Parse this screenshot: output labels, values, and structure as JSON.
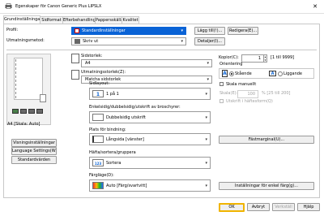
{
  "window": {
    "title": "Egenskaper för Canon Generic Plus LIPSLX",
    "close_glyph": "✕"
  },
  "tabs": [
    "Grundinställningar",
    "Sidformat",
    "Efterbehandling",
    "Pappersskälla",
    "Kvalitet"
  ],
  "profile": {
    "label": "Profil:",
    "value": "Standardinställningar",
    "add_label": "Lägg till(!)...",
    "edit_label": "Redigera(E)..."
  },
  "output_method": {
    "label": "Utmatningsmetod:",
    "value": "Skriv ut",
    "details_label": "Detaljer(I)..."
  },
  "preview": {
    "caption": "A4 [Skala: Auto]"
  },
  "left_buttons": {
    "view_settings": "Visningsinställningar",
    "language_settings": "Language Settings(W)...",
    "default_settings": "Standardvärden"
  },
  "page_size": {
    "label": "Sidstorlek:",
    "value": "A4"
  },
  "output_size": {
    "label": "Utmatningsstorlek(Z):",
    "value": "Matcha sidstorlek"
  },
  "copies": {
    "label": "Kopior(C):",
    "value": "1",
    "range": "[1 till 9999]"
  },
  "orientation": {
    "label": "Orientering",
    "portrait": "Stående",
    "landscape": "Liggande"
  },
  "page_layout": {
    "label": "Sidlayout:",
    "value": "1 på 1"
  },
  "manual_scaling": {
    "label": "Skala manuellt",
    "scale_label": "Skala(E):",
    "scale_value": "100",
    "scale_range": "% [25 till 200]"
  },
  "watermark": {
    "label": "Utskrift i häftesform(Q)"
  },
  "duplex": {
    "label": "Enkelsidig/dubbelsidig/utskrift av broschyrer:",
    "value": "Dubbelsidig utskrift"
  },
  "binding_location": {
    "label": "Plats för bindning:",
    "value": "Långsida [vänster]",
    "margin_button": "Fästmarginal(U)..."
  },
  "finishing": {
    "label": "Häfta/sortera/gruppera",
    "value": "Sortera"
  },
  "color_mode": {
    "label": "Färgläge(D):",
    "value": "Auto [Färg/svartvitt]",
    "color_settings_button": "Inställningar för enkel färg(g)..."
  },
  "footer": {
    "ok": "OK",
    "cancel": "Avbryt",
    "apply": "Verkställ",
    "help": "Hjälp"
  },
  "colors": {
    "accent": "#0a63d6",
    "ok_border": "#f0b400",
    "icon_gold": "#e0b000"
  }
}
